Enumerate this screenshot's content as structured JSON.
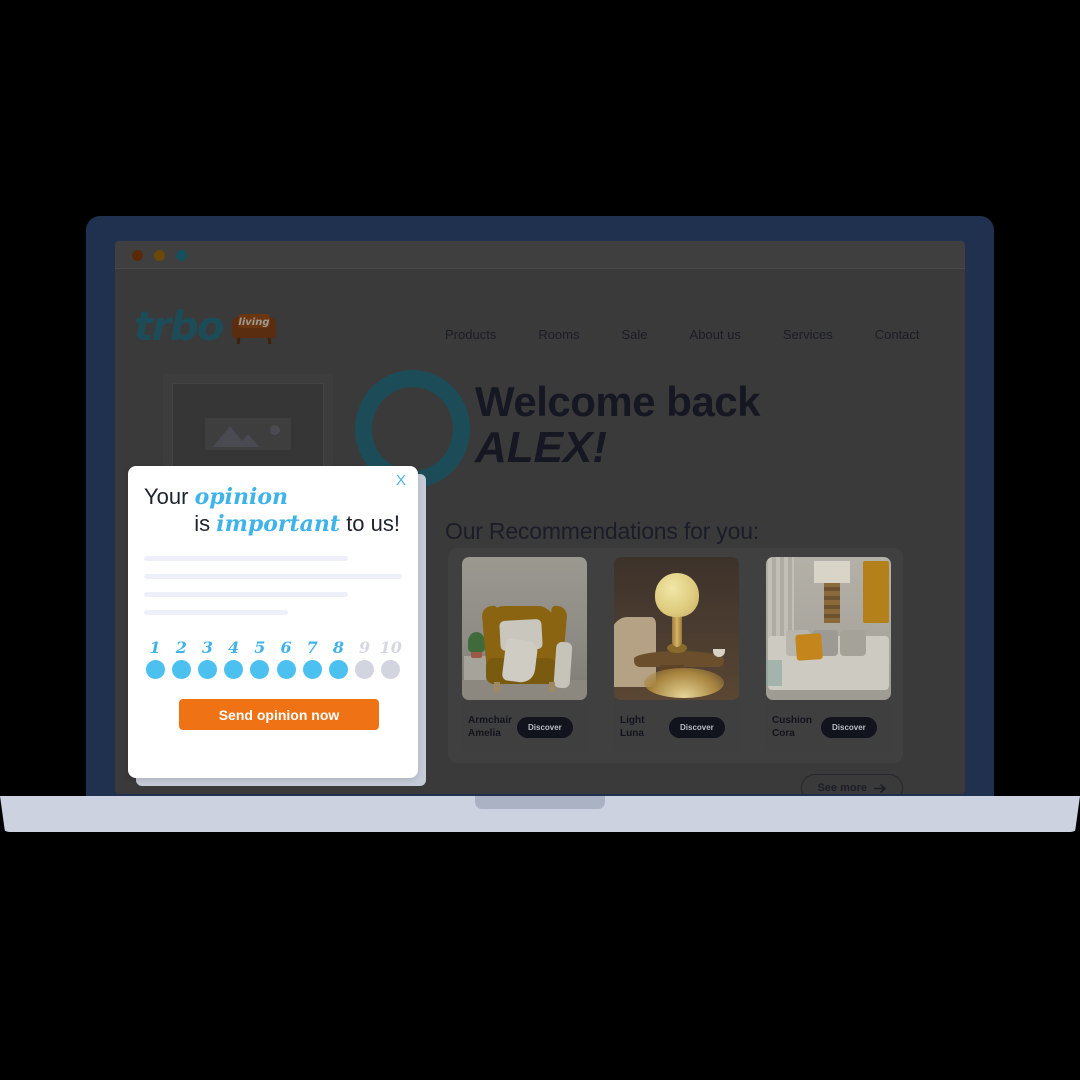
{
  "browser": {
    "dots": [
      "close-dot",
      "minimize-dot",
      "maximize-dot"
    ]
  },
  "site": {
    "logo": {
      "wordmark": "trbo",
      "badge_label": "living"
    },
    "nav": [
      {
        "label": "Products"
      },
      {
        "label": "Rooms"
      },
      {
        "label": "Sale"
      },
      {
        "label": "About us"
      },
      {
        "label": "Services"
      },
      {
        "label": "Contact"
      }
    ],
    "hero": {
      "greeting": "Welcome back",
      "customer_name": "ALEX!"
    },
    "recommendations": {
      "title": "Our Recommendations for you:",
      "cards": [
        {
          "name_line1": "Armchair",
          "name_line2": "Amelia",
          "cta": "Discover"
        },
        {
          "name_line1": "Light",
          "name_line2": "Luna",
          "cta": "Discover"
        },
        {
          "name_line1": "Cushion",
          "name_line2": "Cora",
          "cta": "Discover"
        }
      ],
      "see_more_label": "See more",
      "see_more_icon": "arrow-right-icon"
    }
  },
  "popup": {
    "close_label": "X",
    "heading": {
      "line1_pre": "Your ",
      "line1_em": "opinion",
      "line2_pre": "is ",
      "line2_em": "important",
      "line2_post": " to us!"
    },
    "skeleton_widths": [
      "79%",
      "100%",
      "79%",
      "56%"
    ],
    "rating": {
      "values": [
        "1",
        "2",
        "3",
        "4",
        "5",
        "6",
        "7",
        "8",
        "9",
        "10"
      ],
      "selected_max": 8,
      "active_color": "#4cc0ef",
      "inactive_color": "#d2d5e0"
    },
    "submit_label": "Send opinion now",
    "submit_color": "#ef7215"
  }
}
